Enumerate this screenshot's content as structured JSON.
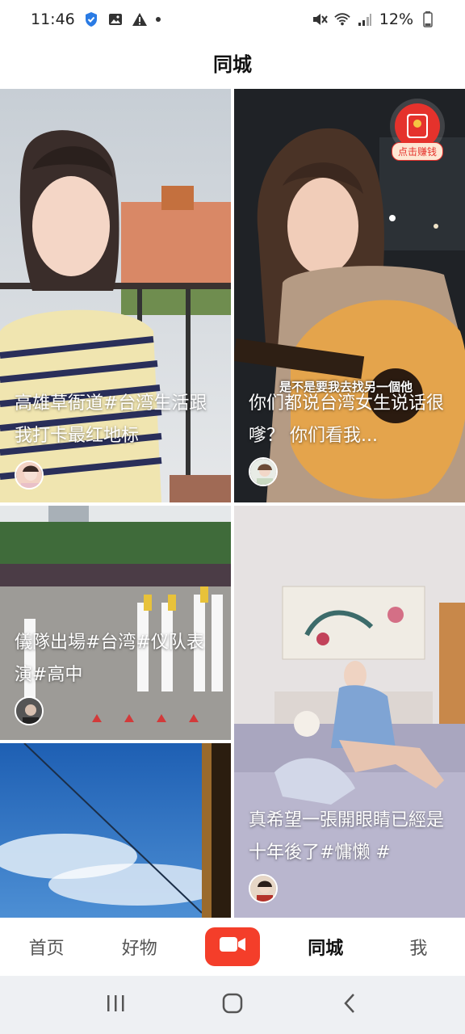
{
  "status_bar": {
    "time": "11:46",
    "battery": "12%"
  },
  "header": {
    "title": "同城"
  },
  "feed": {
    "cards": [
      {
        "caption": "高雄草衙道#台湾生活跟我打卡最红地标"
      },
      {
        "caption": "你们都说台湾女生说话很嗲？ 你们看我...",
        "overlay_subtitle": "是不是要我去找另一個他",
        "badge": "点击赚钱"
      },
      {
        "caption": "儀隊出場#台湾#仪队表演#高中"
      },
      {
        "caption": "真希望一張開眼睛已經是十年後了#慵懒 #"
      },
      {
        "caption": ""
      }
    ]
  },
  "bottom_nav": {
    "items": [
      {
        "label": "首页"
      },
      {
        "label": "好物"
      },
      {
        "label": "同城"
      },
      {
        "label": "我"
      }
    ],
    "active": "同城"
  },
  "colors": {
    "accent": "#f43e2a",
    "redpack": "#e5322c"
  }
}
